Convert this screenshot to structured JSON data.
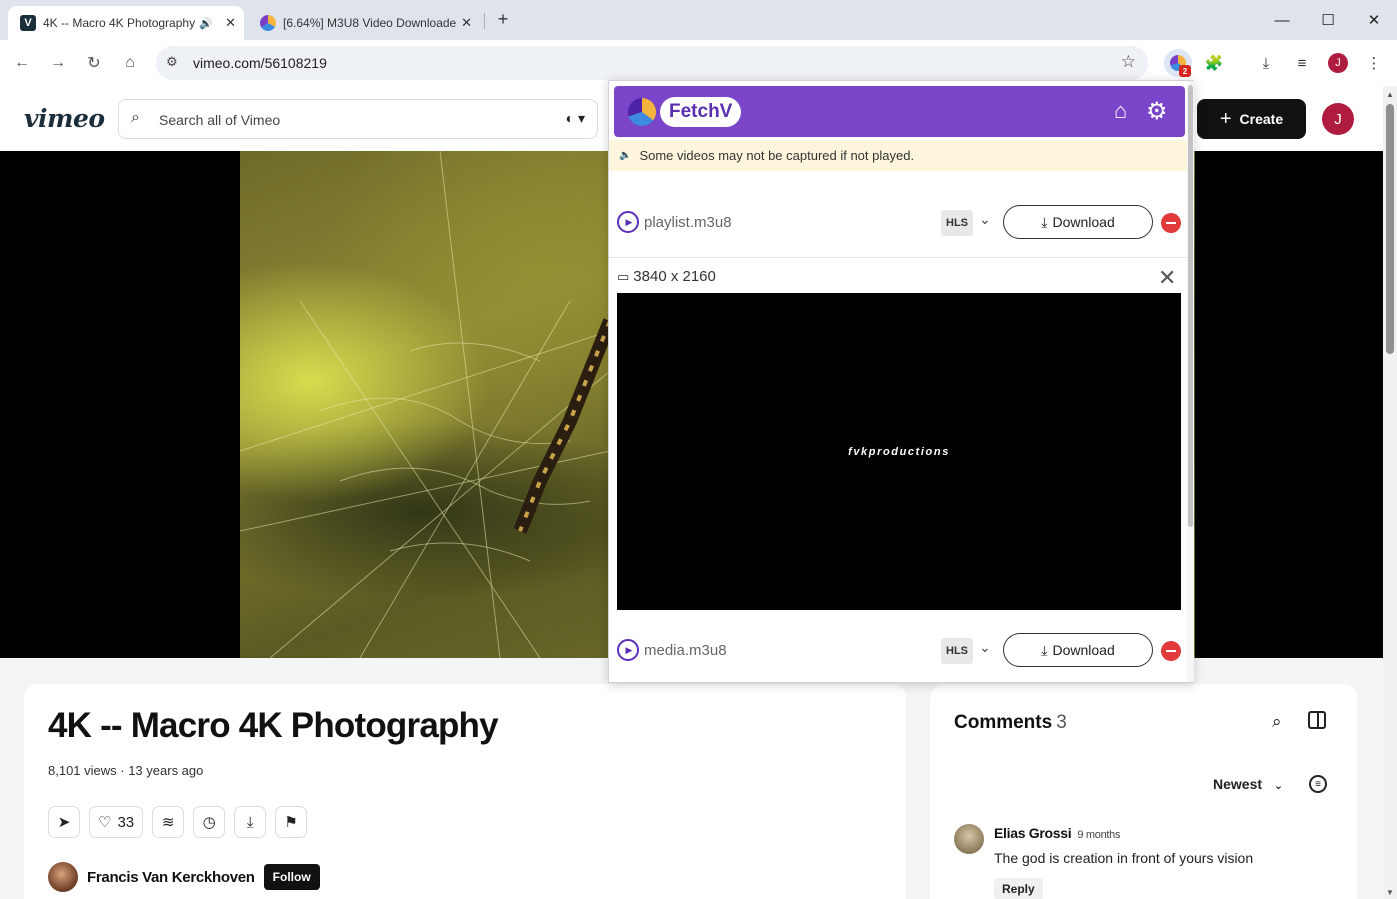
{
  "browser": {
    "tabs": [
      {
        "title": "4K -- Macro 4K Photography",
        "favicon": "vimeo-v",
        "audio": true
      },
      {
        "title": "[6.64%] M3U8 Video Downloader",
        "favicon": "fetchv"
      }
    ],
    "url": "vimeo.com/56108219",
    "extension_badge": "2",
    "profile_initial": "J"
  },
  "vimeo": {
    "logo": "vimeo",
    "search_placeholder": "Search all of Vimeo",
    "create_label": "Create",
    "avatar_initial": "J",
    "video": {
      "title": "4K -- Macro 4K Photography",
      "meta": "8,101 views · 13 years ago",
      "like_count": "33",
      "owner": "Francis Van Kerckhoven",
      "follow_label": "Follow"
    },
    "comments": {
      "title": "Comments",
      "count": "3",
      "sort": "Newest",
      "items": [
        {
          "author": "Elias Grossi",
          "time": "9 months",
          "text": "The god is creation in front of yours vision",
          "reply_label": "Reply"
        }
      ]
    }
  },
  "fetchv": {
    "brand": "FetchV",
    "notice": "Some videos may not be captured if not played.",
    "items": [
      {
        "file": "playlist.m3u8",
        "format": "HLS",
        "download_label": "Download"
      },
      {
        "file": "media.m3u8",
        "format": "HLS",
        "download_label": "Download"
      }
    ],
    "resolution": "3840 x 2160",
    "preview_watermark": "fvkproductions",
    "accent_color": "#7a45c8"
  }
}
